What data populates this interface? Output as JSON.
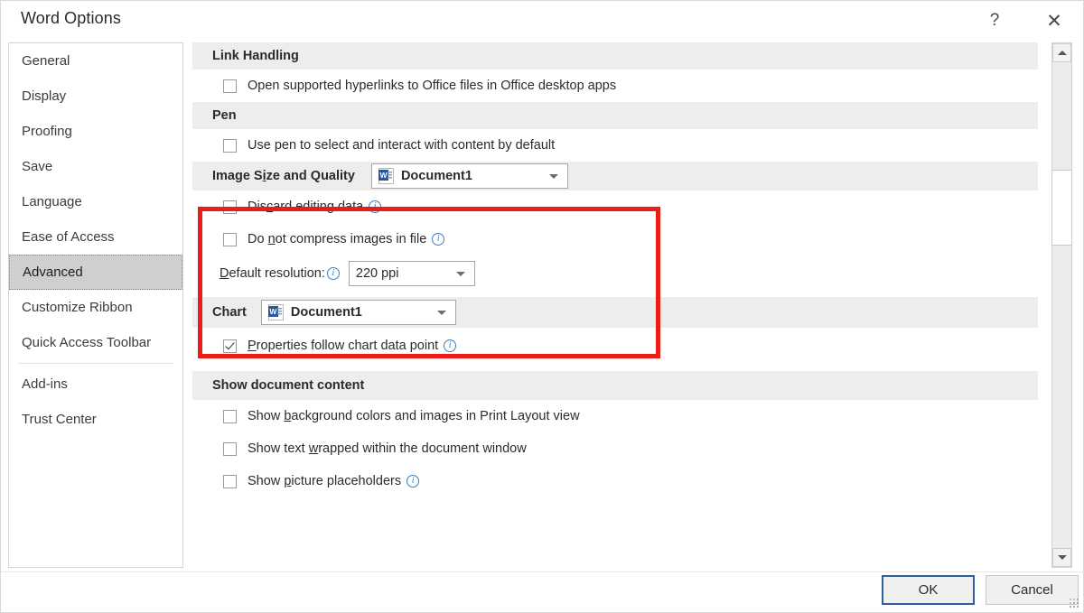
{
  "window": {
    "title": "Word Options",
    "help_label": "?",
    "close_label": "✕"
  },
  "sidebar": {
    "items": [
      {
        "label": "General",
        "selected": false,
        "sep_after": false
      },
      {
        "label": "Display",
        "selected": false,
        "sep_after": false
      },
      {
        "label": "Proofing",
        "selected": false,
        "sep_after": false
      },
      {
        "label": "Save",
        "selected": false,
        "sep_after": false
      },
      {
        "label": "Language",
        "selected": false,
        "sep_after": false
      },
      {
        "label": "Ease of Access",
        "selected": false,
        "sep_after": false
      },
      {
        "label": "Advanced",
        "selected": true,
        "sep_after": false
      },
      {
        "label": "Customize Ribbon",
        "selected": false,
        "sep_after": false
      },
      {
        "label": "Quick Access Toolbar",
        "selected": false,
        "sep_after": true
      },
      {
        "label": "Add-ins",
        "selected": false,
        "sep_after": false
      },
      {
        "label": "Trust Center",
        "selected": false,
        "sep_after": false
      }
    ]
  },
  "pane": {
    "link_handling": {
      "heading": "Link Handling",
      "option_1": {
        "label_pre": "Open supported hyperlinks to Office files in Office desktop apps",
        "checked": false
      }
    },
    "pen": {
      "heading": "Pen",
      "option_1": {
        "label_pre": "Use pen to select and interact with content by default",
        "checked": false
      }
    },
    "image_size_quality": {
      "heading": "Image S",
      "heading_accel": "i",
      "heading_rest": "ze and Quality",
      "scope_value": "Document1",
      "scope_icon": "word-document-icon",
      "discard": {
        "pre": "Dis",
        "accel": "c",
        "post": "ard editing data",
        "checked": false,
        "info": true
      },
      "no_compress": {
        "pre": "Do ",
        "accel": "n",
        "post": "ot compress images in file",
        "checked": false,
        "info": true
      },
      "resolution": {
        "accel": "D",
        "label_rest": "efault resolution:",
        "info": true,
        "value": "220 ppi"
      }
    },
    "chart": {
      "heading": "Chart",
      "scope_value": "Document1",
      "scope_icon": "word-document-icon",
      "properties_follow": {
        "accel": "P",
        "label_rest": "roperties follow chart data point",
        "checked": true,
        "info": true
      }
    },
    "show_document_content": {
      "heading": "Show document content",
      "options": [
        {
          "pre": "Show ",
          "accel": "b",
          "post": "ackground colors and images in Print Layout view",
          "checked": false,
          "info": false
        },
        {
          "pre": "Show text ",
          "accel": "w",
          "post": "rapped within the document window",
          "checked": false,
          "info": false
        },
        {
          "pre": "Show ",
          "accel": "p",
          "post": "icture placeholders",
          "checked": false,
          "info": true
        }
      ]
    }
  },
  "footer": {
    "ok_label": "OK",
    "cancel_label": "Cancel"
  },
  "annotation": {
    "highlight_color": "#ec1c18"
  }
}
